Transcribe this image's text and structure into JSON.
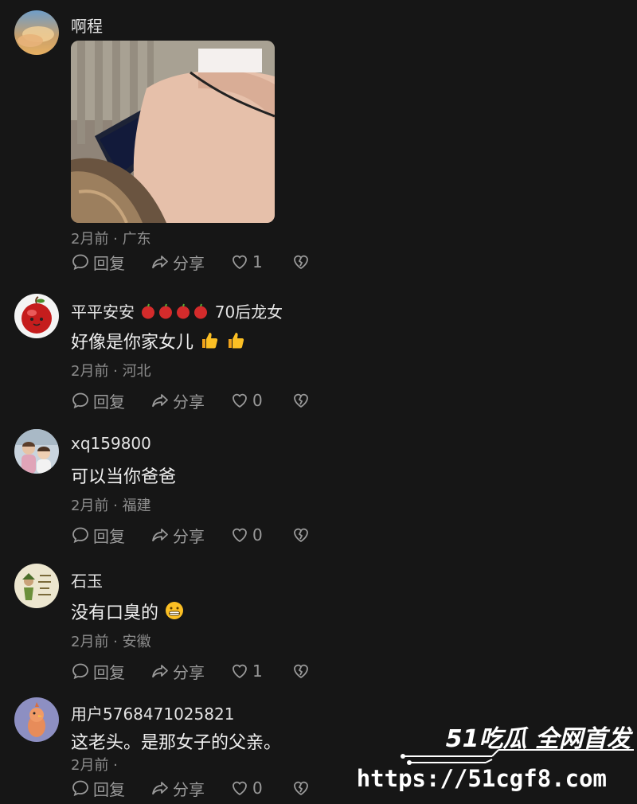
{
  "comments": [
    {
      "username": "啊程",
      "text": "",
      "meta": "2月前 · 广东",
      "reply_label": "回复",
      "share_label": "分享",
      "like_count": "1",
      "has_photo": true
    },
    {
      "username": "平平安安",
      "username_suffix": "70后龙女",
      "username_emoji": "apple",
      "text": "好像是你家女儿",
      "text_emoji": "thumbs-up",
      "meta": "2月前 · 河北",
      "reply_label": "回复",
      "share_label": "分享",
      "like_count": "0"
    },
    {
      "username": "xq159800",
      "text": "可以当你爸爸",
      "meta": "2月前 · 福建",
      "reply_label": "回复",
      "share_label": "分享",
      "like_count": "0"
    },
    {
      "username": "石玉",
      "text": "没有口臭的",
      "text_emoji": "grinning-face",
      "meta": "2月前 · 安徽",
      "reply_label": "回复",
      "share_label": "分享",
      "like_count": "1"
    },
    {
      "username": "用户5768471025821",
      "text": "这老头。是那女子的父亲。",
      "meta": "2月前 ·",
      "reply_label": "回复",
      "share_label": "分享",
      "like_count": "0"
    }
  ],
  "watermark": {
    "title": "51吃瓜 全网首发",
    "url": "https://51cgf8.com"
  },
  "colors": {
    "background": "#161616",
    "meta_text": "#8d8d8d",
    "action_text": "#9a9a9a"
  },
  "icons": [
    "reply-icon",
    "share-icon",
    "heart-icon",
    "broken-heart-icon"
  ]
}
